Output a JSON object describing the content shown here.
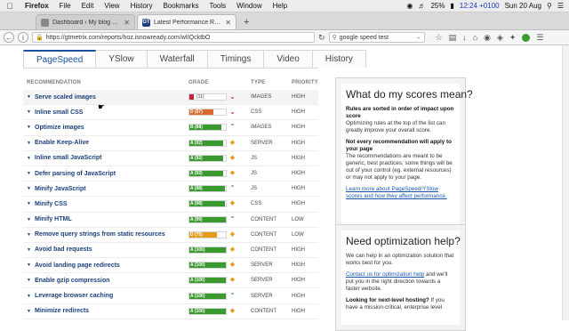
{
  "menubar": {
    "apple_icon": "apple-icon",
    "items": [
      "Firefox",
      "File",
      "Edit",
      "View",
      "History",
      "Bookmarks",
      "Tools",
      "Window",
      "Help"
    ],
    "battery": "25%",
    "clock": "12:24 +0100",
    "date": "Sun 20 Aug"
  },
  "browser": {
    "tabs": [
      {
        "title": "Dashboard ‹ My blog — WordPress",
        "active": false
      },
      {
        "title": "Latest Performance Report for",
        "active": true,
        "favicon": "GT"
      }
    ],
    "new_tab": "+",
    "url": "https://gtmetrix.com/reports/hoz.isnowready.com/wIIQcktbO",
    "search": "google speed test"
  },
  "page": {
    "tabs": [
      "PageSpeed",
      "YSlow",
      "Waterfall",
      "Timings",
      "Video",
      "History"
    ],
    "active_tab": "PageSpeed",
    "columns": {
      "recommendation": "RECOMMENDATION",
      "grade": "GRADE",
      "type": "TYPE",
      "priority": "PRIORITY"
    },
    "rows": [
      {
        "name": "Serve scaled images",
        "grade_label": "(11)",
        "grade_value": 11,
        "color": "#c2263a",
        "trend": "down",
        "type": "IMAGES",
        "priority": "HIGH"
      },
      {
        "name": "Inline small CSS",
        "grade_label": "D (67)",
        "grade_value": 67,
        "color": "#d9692a",
        "trend": "down",
        "type": "CSS",
        "priority": "HIGH"
      },
      {
        "name": "Optimize images",
        "grade_label": "B (88)",
        "grade_value": 88,
        "color": "#3a9a2f",
        "trend": "up",
        "type": "IMAGES",
        "priority": "HIGH"
      },
      {
        "name": "Enable Keep-Alive",
        "grade_label": "A (92)",
        "grade_value": 92,
        "color": "#3a9a2f",
        "trend": "diamond",
        "type": "SERVER",
        "priority": "HIGH"
      },
      {
        "name": "Inline small JavaScript",
        "grade_label": "A (92)",
        "grade_value": 92,
        "color": "#3a9a2f",
        "trend": "diamond",
        "type": "JS",
        "priority": "HIGH"
      },
      {
        "name": "Defer parsing of JavaScript",
        "grade_label": "A (92)",
        "grade_value": 92,
        "color": "#3a9a2f",
        "trend": "diamond",
        "type": "JS",
        "priority": "HIGH"
      },
      {
        "name": "Minify JavaScript",
        "grade_label": "A (98)",
        "grade_value": 98,
        "color": "#3a9a2f",
        "trend": "up",
        "type": "JS",
        "priority": "HIGH"
      },
      {
        "name": "Minify CSS",
        "grade_label": "A (98)",
        "grade_value": 98,
        "color": "#3a9a2f",
        "trend": "diamond",
        "type": "CSS",
        "priority": "HIGH"
      },
      {
        "name": "Minify HTML",
        "grade_label": "A (99)",
        "grade_value": 99,
        "color": "#3a9a2f",
        "trend": "up",
        "type": "CONTENT",
        "priority": "LOW"
      },
      {
        "name": "Remove query strings from static resources",
        "grade_label": "D (75)",
        "grade_value": 75,
        "color": "#e29b1b",
        "trend": "diamond",
        "type": "CONTENT",
        "priority": "LOW"
      },
      {
        "name": "Avoid bad requests",
        "grade_label": "A (100)",
        "grade_value": 100,
        "color": "#3a9a2f",
        "trend": "diamond",
        "type": "CONTENT",
        "priority": "HIGH"
      },
      {
        "name": "Avoid landing page redirects",
        "grade_label": "A (100)",
        "grade_value": 100,
        "color": "#3a9a2f",
        "trend": "diamond",
        "type": "SERVER",
        "priority": "HIGH"
      },
      {
        "name": "Enable gzip compression",
        "grade_label": "A (100)",
        "grade_value": 100,
        "color": "#3a9a2f",
        "trend": "diamond",
        "type": "SERVER",
        "priority": "HIGH"
      },
      {
        "name": "Leverage browser caching",
        "grade_label": "A (100)",
        "grade_value": 100,
        "color": "#3a9a2f",
        "trend": "up",
        "type": "SERVER",
        "priority": "HIGH"
      },
      {
        "name": "Minimize redirects",
        "grade_label": "A (100)",
        "grade_value": 100,
        "color": "#3a9a2f",
        "trend": "diamond",
        "type": "CONTENT",
        "priority": "HIGH"
      }
    ]
  },
  "scores_panel": {
    "title": "What do my scores mean?",
    "p1_bold": "Rules are sorted in order of impact upon score",
    "p1": "Optimizing rules at the top of the list can greatly improve your overall score.",
    "p2_bold": "Not every recommendation will apply to your page",
    "p2": "The recommendations are meant to be generic, best practices; some things will be out of your control (eg. external resources) or may not apply to your page.",
    "link": "Learn more about PageSpeed/YSlow scores and how they affect performance."
  },
  "help_panel": {
    "title": "Need optimization help?",
    "p1": "We can help in an optimization solution that works best for you.",
    "link": "Contact us for optimization help",
    "p2": " and we'll put you in the right direction towards a faster website.",
    "p3_bold": "Looking for next-level hosting?",
    "p3": " If you have a mission-critical, enterprise level"
  }
}
